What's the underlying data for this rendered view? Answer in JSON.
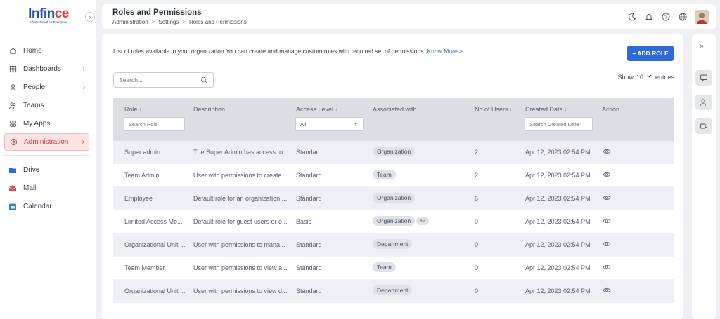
{
  "brand": {
    "logo_text_1": "Inf",
    "logo_text_2": "in",
    "logo_text_3": "ce",
    "tagline": "Infinite Cloud for Enterprise"
  },
  "sidebar": {
    "collapse_glyph": "«",
    "items": [
      {
        "label": "Home",
        "icon": "home-icon"
      },
      {
        "label": "Dashboards",
        "icon": "dashboard-icon",
        "chevron": "›"
      },
      {
        "label": "People",
        "icon": "person-icon",
        "chevron": "›"
      },
      {
        "label": "Teams",
        "icon": "teams-icon"
      },
      {
        "label": "My Apps",
        "icon": "apps-icon"
      },
      {
        "label": "Administration",
        "icon": "admin-icon",
        "chevron": "›",
        "active": true
      }
    ],
    "apps": [
      {
        "label": "Drive",
        "icon": "drive-icon",
        "color": "#2f6bd8"
      },
      {
        "label": "Mail",
        "icon": "mail-icon",
        "color": "#e24a4a"
      },
      {
        "label": "Calendar",
        "icon": "calendar-icon",
        "color": "#2f80d8"
      }
    ]
  },
  "header": {
    "title": "Roles and Permissions",
    "breadcrumb": [
      "Administration",
      "Settings",
      "Roles and Permissions"
    ],
    "breadcrumb_sep": ">"
  },
  "main": {
    "intro": "List of roles available in your organization.You can create and manage custom roles with required set of permissions.",
    "know_more": "Know More >",
    "add_role": "+ ADD ROLE",
    "search_placeholder": "Search...",
    "show_label": "Show",
    "show_value": "10",
    "entries_label": "entries"
  },
  "table": {
    "columns": {
      "role": "Role",
      "description": "Description",
      "access_level": "Access Level",
      "associated": "Associated with",
      "users": "No.of Users",
      "created": "Created Date",
      "action": "Action"
    },
    "sort_arrow": "↑",
    "filters": {
      "role_placeholder": "Search Role",
      "access_value": "All",
      "created_placeholder": "Search Created Date"
    },
    "rows": [
      {
        "role": "Super admin",
        "description": "The Super Admin has access to ...",
        "access": "Standard",
        "associated": "Organization",
        "more": "",
        "users": "2",
        "created": "Apr 12, 2023 02:54 PM"
      },
      {
        "role": "Team Admin",
        "description": "User with permissions to create...",
        "access": "Standard",
        "associated": "Team",
        "more": "",
        "users": "2",
        "created": "Apr 12, 2023 02:54 PM"
      },
      {
        "role": "Employee",
        "description": "Default role for an organization ...",
        "access": "Standard",
        "associated": "Organization",
        "more": "",
        "users": "6",
        "created": "Apr 12, 2023 02:54 PM"
      },
      {
        "role": "Limited Access Me...",
        "description": "Default role for guest users or e...",
        "access": "Basic",
        "associated": "Organization",
        "more": "+2",
        "users": "0",
        "created": "Apr 12, 2023 02:54 PM"
      },
      {
        "role": "Organizational Unit ...",
        "description": "User with permissions to mana...",
        "access": "Standard",
        "associated": "Department",
        "more": "",
        "users": "0",
        "created": "Apr 12, 2023 02:54 PM"
      },
      {
        "role": "Team Member",
        "description": "User with permissions to view a...",
        "access": "Standard",
        "associated": "Team",
        "more": "",
        "users": "0",
        "created": "Apr 12, 2023 02:54 PM"
      },
      {
        "role": "Organizational Unit ...",
        "description": "User with permissions to view d...",
        "access": "Standard",
        "associated": "Department",
        "more": "",
        "users": "0",
        "created": "Apr 12, 2023 02:54 PM"
      }
    ]
  },
  "rail": {
    "toggle_glyph": "»"
  }
}
